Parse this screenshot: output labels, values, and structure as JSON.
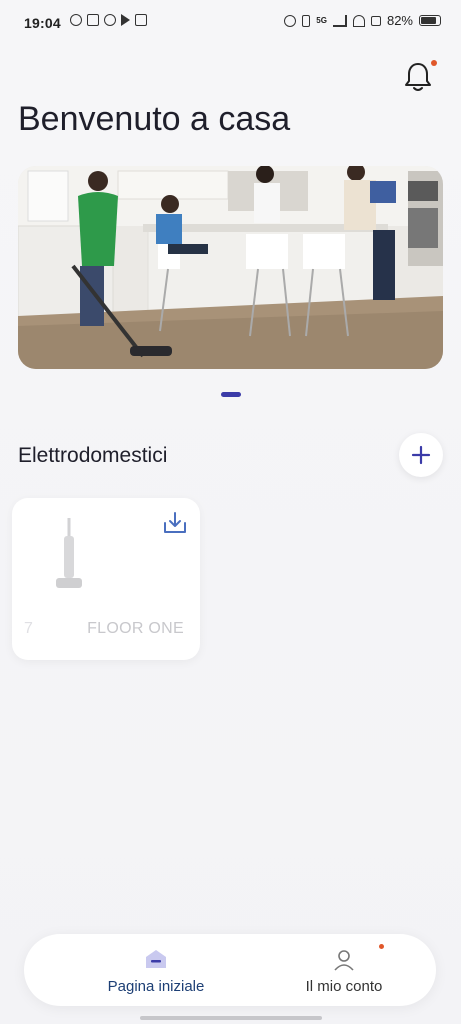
{
  "status_bar": {
    "time": "19:04",
    "battery": "82%",
    "network": "5G"
  },
  "header": {
    "title": "Benvenuto a casa"
  },
  "carousel": {
    "pages": 1,
    "active": 1
  },
  "appliances": {
    "section_title": "Elettrodomestici",
    "add_label": "+",
    "devices": [
      {
        "name_prefix": "7",
        "name": "FLOOR ONE"
      }
    ]
  },
  "bottom_nav": {
    "home_label": "Pagina iniziale",
    "account_label": "Il mio conto"
  },
  "colors": {
    "accent": "#3b3ba8",
    "notification": "#e0572a",
    "home_active": "#1d3f75"
  }
}
